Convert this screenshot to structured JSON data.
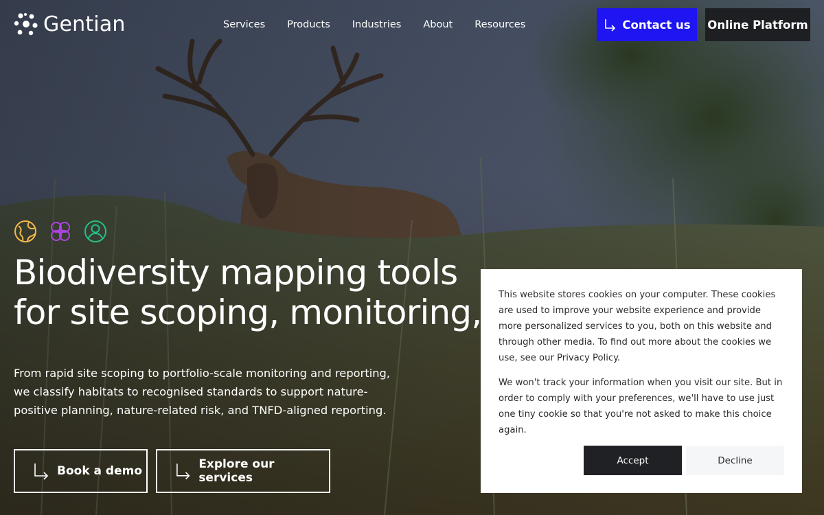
{
  "brand": {
    "name": "Gentian",
    "logo_icon": "gentian-flower-logo-icon"
  },
  "nav": {
    "items": [
      {
        "label": "Services"
      },
      {
        "label": "Products"
      },
      {
        "label": "Industries"
      },
      {
        "label": "About"
      },
      {
        "label": "Resources"
      }
    ]
  },
  "header": {
    "contact_label": "Contact us",
    "contact_icon": "arrow-down-right-icon",
    "platform_label": "Online Platform"
  },
  "hero": {
    "background": "red-deer-stag-in-meadow-photo",
    "feature_icons": [
      "globe-icon",
      "flower-icon",
      "person-icon"
    ],
    "title_line_1": "Biodiversity mapping tools",
    "title_line_2": "for site scoping, monitoring, and reporting",
    "subtitle_line_1": "From rapid site scoping to portfolio-scale monitoring and reporting,",
    "subtitle_line_2": "we classify habitats to recognised standards to support nature-",
    "subtitle_line_3": "positive planning, nature-related risk, and TNFD-aligned reporting.",
    "cta_primary": "Book a demo",
    "cta_secondary": "Explore our services"
  },
  "cookie_banner": {
    "paragraph_1": "This website stores cookies on your computer. These cookies are used to improve your website experience and provide more personalized services to you, both on this website and through other media. To find out more about the cookies we use, see our Privacy Policy.",
    "paragraph_2": "We won't track your information when you visit our site. But in order to comply with your preferences, we'll have to use just one tiny cookie so that you're not asked to make this choice again.",
    "accept_label": "Accept",
    "decline_label": "Decline"
  },
  "colors": {
    "contact_button": "#1f14f2",
    "platform_button": "#1e1f22",
    "icon_globe": "#f2b84b",
    "icon_flower": "#b043e6",
    "icon_person": "#22c08a"
  }
}
